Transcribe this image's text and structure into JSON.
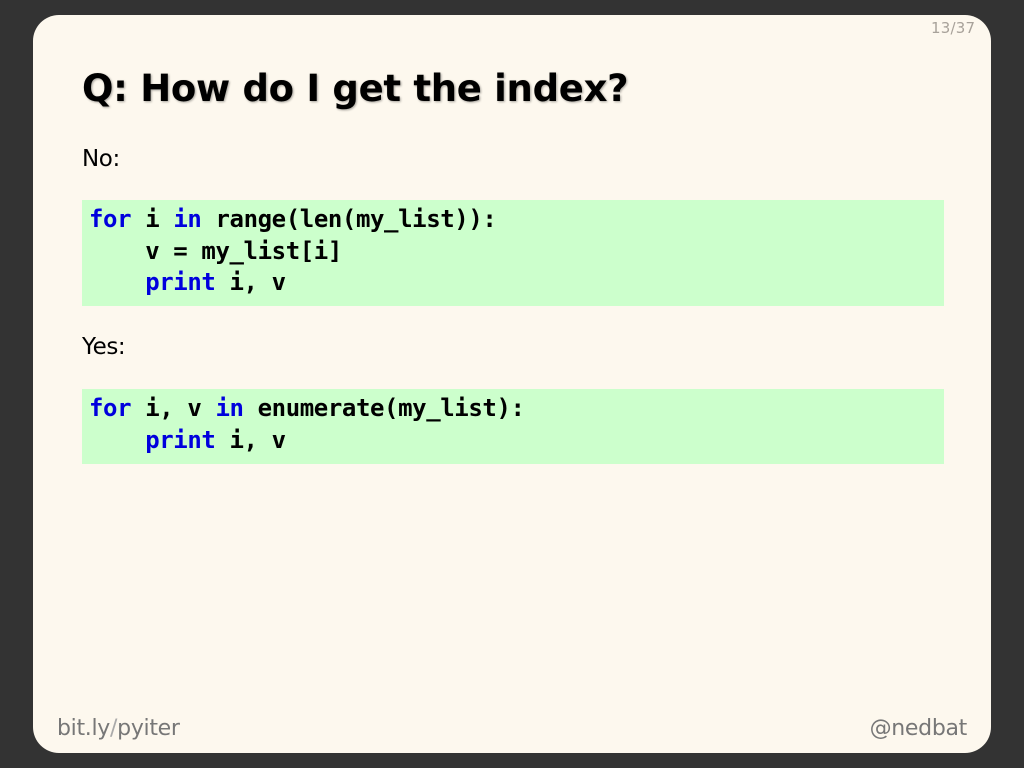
{
  "slide": {
    "page_number": "13/37",
    "title": "Q: How do I get the index?",
    "sections": {
      "no": {
        "label": "No:",
        "code_lines": [
          [
            {
              "text": "for",
              "kind": "keyword"
            },
            {
              "text": " i ",
              "kind": "plain"
            },
            {
              "text": "in",
              "kind": "keyword"
            },
            {
              "text": " range(len(my_list)):",
              "kind": "plain"
            }
          ],
          [
            {
              "text": "    v = my_list[i]",
              "kind": "plain"
            }
          ],
          [
            {
              "text": "    ",
              "kind": "plain"
            },
            {
              "text": "print",
              "kind": "keyword"
            },
            {
              "text": " i, v",
              "kind": "plain"
            }
          ]
        ]
      },
      "yes": {
        "label": "Yes:",
        "code_lines": [
          [
            {
              "text": "for",
              "kind": "keyword"
            },
            {
              "text": " i, v ",
              "kind": "plain"
            },
            {
              "text": "in",
              "kind": "keyword"
            },
            {
              "text": " enumerate(my_list):",
              "kind": "plain"
            }
          ],
          [
            {
              "text": "    ",
              "kind": "plain"
            },
            {
              "text": "print",
              "kind": "keyword"
            },
            {
              "text": " i, v",
              "kind": "plain"
            }
          ]
        ]
      }
    },
    "footer": {
      "left_host": "bit.ly",
      "left_sep": "/",
      "left_path": "pyiter",
      "right": "@nedbat"
    }
  },
  "colors": {
    "background": "#333333",
    "slide": "#fdf8ee",
    "code_background": "#ccffcc",
    "keyword": "#0000dd",
    "footer_text": "#777777"
  }
}
